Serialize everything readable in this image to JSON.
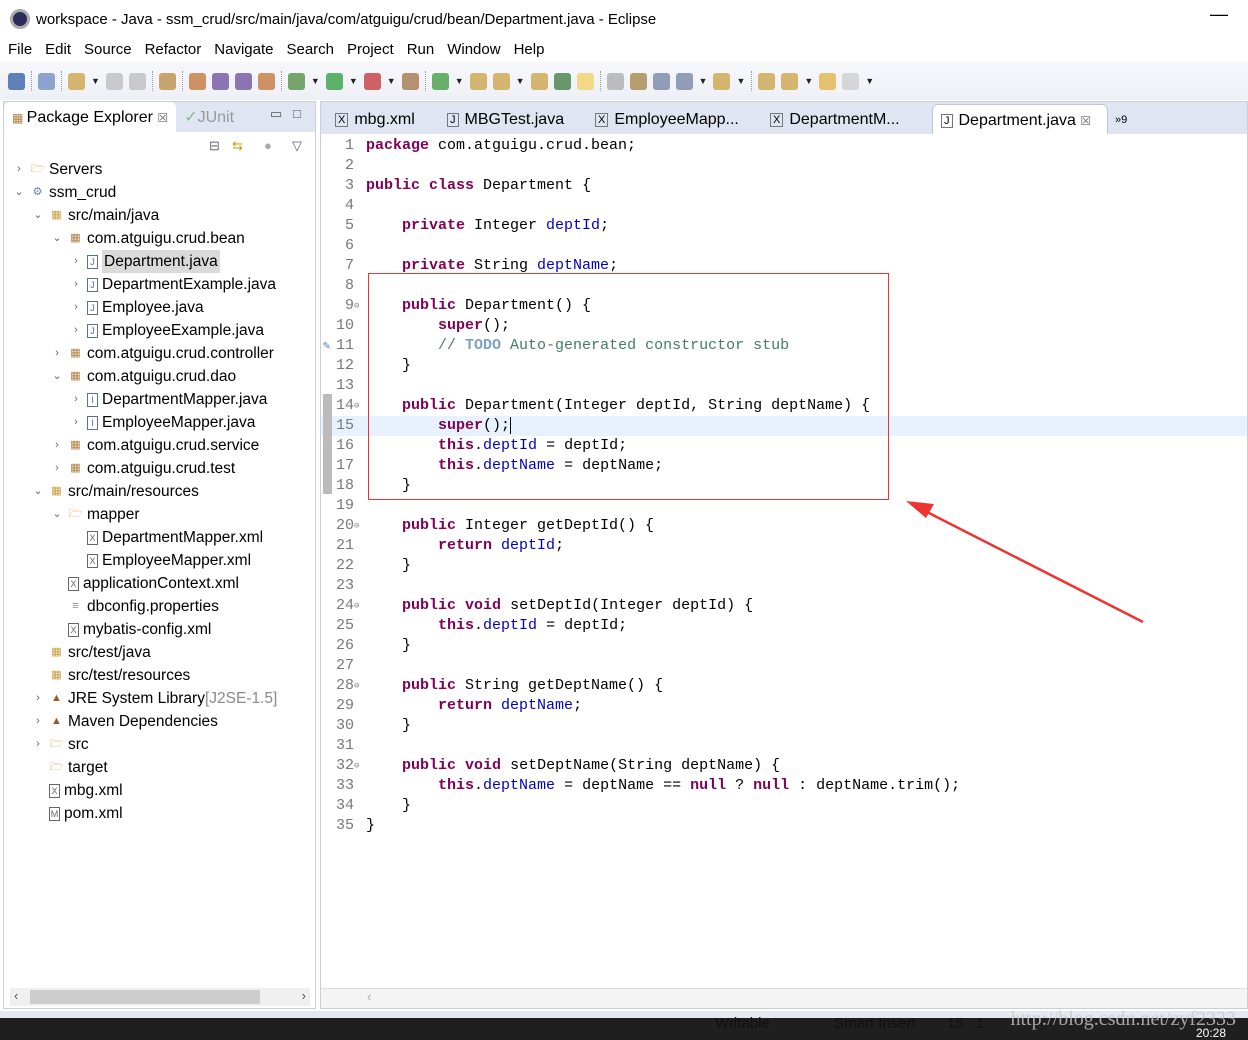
{
  "window": {
    "title": "workspace - Java - ssm_crud/src/main/java/com/atguigu/crud/bean/Department.java - Eclipse",
    "minimize": "—"
  },
  "menu": [
    "File",
    "Edit",
    "Source",
    "Refactor",
    "Navigate",
    "Search",
    "Project",
    "Run",
    "Window",
    "Help"
  ],
  "left": {
    "tabs": [
      {
        "label": "Package Explorer",
        "close": "☒"
      },
      {
        "label": "JUnit"
      }
    ],
    "tree": [
      {
        "label": "Servers",
        "depth": 0,
        "tw": "›",
        "icon": "folder-icon",
        "c": "#d8a23a"
      },
      {
        "label": "ssm_crud",
        "depth": 0,
        "tw": "⌄",
        "icon": "project-icon",
        "c": "#6a7fb0"
      },
      {
        "label": "src/main/java",
        "depth": 1,
        "tw": "⌄",
        "icon": "source-folder-icon",
        "c": "#c89a3a"
      },
      {
        "label": "com.atguigu.crud.bean",
        "depth": 2,
        "tw": "⌄",
        "icon": "package-icon",
        "c": "#b07a3a"
      },
      {
        "label": "Department.java",
        "depth": 3,
        "tw": "›",
        "icon": "java-file-icon",
        "c": "#5a6ea0",
        "sel": true
      },
      {
        "label": "DepartmentExample.java",
        "depth": 3,
        "tw": "›",
        "icon": "java-file-icon",
        "c": "#5a6ea0"
      },
      {
        "label": "Employee.java",
        "depth": 3,
        "tw": "›",
        "icon": "java-file-icon",
        "c": "#5a6ea0"
      },
      {
        "label": "EmployeeExample.java",
        "depth": 3,
        "tw": "›",
        "icon": "java-file-icon",
        "c": "#5a6ea0"
      },
      {
        "label": "com.atguigu.crud.controller",
        "depth": 2,
        "tw": "›",
        "icon": "package-icon",
        "c": "#b07a3a"
      },
      {
        "label": "com.atguigu.crud.dao",
        "depth": 2,
        "tw": "⌄",
        "icon": "package-icon",
        "c": "#b07a3a"
      },
      {
        "label": "DepartmentMapper.java",
        "depth": 3,
        "tw": "›",
        "icon": "java-interface-icon",
        "c": "#5a6ea0"
      },
      {
        "label": "EmployeeMapper.java",
        "depth": 3,
        "tw": "›",
        "icon": "java-interface-icon",
        "c": "#5a6ea0"
      },
      {
        "label": "com.atguigu.crud.service",
        "depth": 2,
        "tw": "›",
        "icon": "package-icon",
        "c": "#b07a3a"
      },
      {
        "label": "com.atguigu.crud.test",
        "depth": 2,
        "tw": "›",
        "icon": "package-icon",
        "c": "#b07a3a"
      },
      {
        "label": "src/main/resources",
        "depth": 1,
        "tw": "⌄",
        "icon": "source-folder-icon",
        "c": "#c89a3a"
      },
      {
        "label": "mapper",
        "depth": 2,
        "tw": "⌄",
        "icon": "folder-icon",
        "c": "#d8a23a"
      },
      {
        "label": "DepartmentMapper.xml",
        "depth": 3,
        "tw": "",
        "icon": "xml-file-icon",
        "c": "#666"
      },
      {
        "label": "EmployeeMapper.xml",
        "depth": 3,
        "tw": "",
        "icon": "xml-file-icon",
        "c": "#666"
      },
      {
        "label": "applicationContext.xml",
        "depth": 2,
        "tw": "",
        "icon": "xml-file-icon",
        "c": "#666"
      },
      {
        "label": "dbconfig.properties",
        "depth": 2,
        "tw": "",
        "icon": "properties-file-icon",
        "c": "#888"
      },
      {
        "label": "mybatis-config.xml",
        "depth": 2,
        "tw": "",
        "icon": "xml-file-icon",
        "c": "#666"
      },
      {
        "label": "src/test/java",
        "depth": 1,
        "tw": "",
        "icon": "source-folder-icon",
        "c": "#c89a3a"
      },
      {
        "label": "src/test/resources",
        "depth": 1,
        "tw": "",
        "icon": "source-folder-icon",
        "c": "#c89a3a"
      },
      {
        "label": "JRE System Library",
        "deco": " [J2SE-1.5]",
        "depth": 1,
        "tw": "›",
        "icon": "library-icon",
        "c": "#a05a2a"
      },
      {
        "label": "Maven Dependencies",
        "depth": 1,
        "tw": "›",
        "icon": "library-icon",
        "c": "#a05a2a"
      },
      {
        "label": "src",
        "depth": 1,
        "tw": "›",
        "icon": "folder-icon",
        "c": "#d8a23a"
      },
      {
        "label": "target",
        "depth": 1,
        "tw": "",
        "icon": "folder-icon",
        "c": "#d8a23a"
      },
      {
        "label": "mbg.xml",
        "depth": 1,
        "tw": "",
        "icon": "xml-file-icon",
        "c": "#666"
      },
      {
        "label": "pom.xml",
        "depth": 1,
        "tw": "",
        "icon": "maven-pom-icon",
        "c": "#666"
      }
    ]
  },
  "editor": {
    "tabs": [
      {
        "label": "mbg.xml",
        "icon": "X"
      },
      {
        "label": "MBGTest.java",
        "icon": "J"
      },
      {
        "label": "EmployeeMapp...",
        "icon": "X"
      },
      {
        "label": "DepartmentM...",
        "icon": "X"
      },
      {
        "label": "Department.java",
        "icon": "J",
        "active": true,
        "close": "☒"
      }
    ],
    "overflow": "»9",
    "current_line": 15,
    "lines": [
      [
        [
          "package",
          "kw"
        ],
        [
          " com.atguigu.crud.bean;",
          ""
        ]
      ],
      [],
      [
        [
          "public",
          "kw"
        ],
        [
          " ",
          ""
        ],
        [
          "class",
          "kw"
        ],
        [
          " Department {",
          ""
        ]
      ],
      [],
      [
        [
          "    ",
          ""
        ],
        [
          "private",
          "kw"
        ],
        [
          " Integer ",
          ""
        ],
        [
          "deptId",
          "fd"
        ],
        [
          ";",
          ""
        ]
      ],
      [],
      [
        [
          "    ",
          ""
        ],
        [
          "private",
          "kw"
        ],
        [
          " String ",
          ""
        ],
        [
          "deptName",
          "fd"
        ],
        [
          ";",
          ""
        ]
      ],
      [],
      [
        [
          "    ",
          ""
        ],
        [
          "public",
          "kw"
        ],
        [
          " Department() {",
          ""
        ]
      ],
      [
        [
          "        ",
          ""
        ],
        [
          "super",
          "kw"
        ],
        [
          "();",
          ""
        ]
      ],
      [
        [
          "        ",
          ""
        ],
        [
          "// ",
          "cm"
        ],
        [
          "TODO",
          "td"
        ],
        [
          " Auto-generated constructor stub",
          "cm"
        ]
      ],
      [
        [
          "    }",
          ""
        ]
      ],
      [],
      [
        [
          "    ",
          ""
        ],
        [
          "public",
          "kw"
        ],
        [
          " Department(Integer deptId, String deptName) {",
          ""
        ]
      ],
      [
        [
          "        ",
          ""
        ],
        [
          "super",
          "kw"
        ],
        [
          "();",
          ""
        ]
      ],
      [
        [
          "        ",
          ""
        ],
        [
          "this",
          "kw"
        ],
        [
          ".",
          ""
        ],
        [
          "deptId",
          "fd"
        ],
        [
          " = deptId;",
          ""
        ]
      ],
      [
        [
          "        ",
          ""
        ],
        [
          "this",
          "kw"
        ],
        [
          ".",
          ""
        ],
        [
          "deptName",
          "fd"
        ],
        [
          " = deptName;",
          ""
        ]
      ],
      [
        [
          "    }",
          ""
        ]
      ],
      [],
      [
        [
          "    ",
          ""
        ],
        [
          "public",
          "kw"
        ],
        [
          " Integer getDeptId() {",
          ""
        ]
      ],
      [
        [
          "        ",
          ""
        ],
        [
          "return",
          "kw"
        ],
        [
          " ",
          ""
        ],
        [
          "deptId",
          "fd"
        ],
        [
          ";",
          ""
        ]
      ],
      [
        [
          "    }",
          ""
        ]
      ],
      [],
      [
        [
          "    ",
          ""
        ],
        [
          "public",
          "kw"
        ],
        [
          " ",
          ""
        ],
        [
          "void",
          "kw"
        ],
        [
          " setDeptId(Integer deptId) {",
          ""
        ]
      ],
      [
        [
          "        ",
          ""
        ],
        [
          "this",
          "kw"
        ],
        [
          ".",
          ""
        ],
        [
          "deptId",
          "fd"
        ],
        [
          " = deptId;",
          ""
        ]
      ],
      [
        [
          "    }",
          ""
        ]
      ],
      [],
      [
        [
          "    ",
          ""
        ],
        [
          "public",
          "kw"
        ],
        [
          " String getDeptName() {",
          ""
        ]
      ],
      [
        [
          "        ",
          ""
        ],
        [
          "return",
          "kw"
        ],
        [
          " ",
          ""
        ],
        [
          "deptName",
          "fd"
        ],
        [
          ";",
          ""
        ]
      ],
      [
        [
          "    }",
          ""
        ]
      ],
      [],
      [
        [
          "    ",
          ""
        ],
        [
          "public",
          "kw"
        ],
        [
          " ",
          ""
        ],
        [
          "void",
          "kw"
        ],
        [
          " setDeptName(String deptName) {",
          ""
        ]
      ],
      [
        [
          "        ",
          ""
        ],
        [
          "this",
          "kw"
        ],
        [
          ".",
          ""
        ],
        [
          "deptName",
          "fd"
        ],
        [
          " = deptName == ",
          ""
        ],
        [
          "null",
          "kw"
        ],
        [
          " ? ",
          ""
        ],
        [
          "null",
          "kw"
        ],
        [
          " : deptName.trim();",
          ""
        ]
      ],
      [
        [
          "    }",
          ""
        ]
      ],
      [
        [
          "}",
          ""
        ]
      ]
    ],
    "fold_lines": [
      9,
      14,
      20,
      24,
      28,
      32
    ]
  },
  "status": {
    "writable": "Writable",
    "insert": "Smart Insert",
    "position": "15 : 1"
  },
  "taskbar": {
    "clock": "20:28"
  },
  "watermark": "http://blog.csdn.net/zyf2333",
  "colors": {
    "annotation": "#e33333",
    "keyword": "#7f0055",
    "field": "#0000c0",
    "comment": "#3f7f5f"
  }
}
